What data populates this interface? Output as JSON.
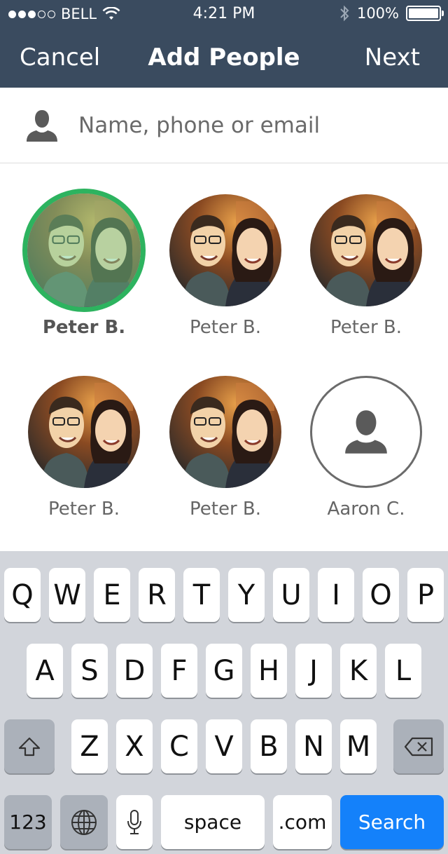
{
  "status_bar": {
    "carrier": "BELL",
    "time": "4:21 PM",
    "battery": "100%",
    "signal_bars_filled": 3,
    "signal_bars_total": 5
  },
  "nav": {
    "cancel_label": "Cancel",
    "title": "Add People",
    "next_label": "Next"
  },
  "search": {
    "placeholder": "Name, phone or email",
    "value": ""
  },
  "people": [
    {
      "name": "Peter B.",
      "selected": true,
      "has_photo": true
    },
    {
      "name": "Peter B.",
      "selected": false,
      "has_photo": true
    },
    {
      "name": "Peter B.",
      "selected": false,
      "has_photo": true
    },
    {
      "name": "Peter B.",
      "selected": false,
      "has_photo": true
    },
    {
      "name": "Peter B.",
      "selected": false,
      "has_photo": true
    },
    {
      "name": "Aaron C.",
      "selected": false,
      "has_photo": false
    }
  ],
  "keyboard": {
    "row1": [
      "Q",
      "W",
      "E",
      "R",
      "T",
      "Y",
      "U",
      "I",
      "O",
      "P"
    ],
    "row2": [
      "A",
      "S",
      "D",
      "F",
      "G",
      "H",
      "J",
      "K",
      "L"
    ],
    "row3": [
      "Z",
      "X",
      "C",
      "V",
      "B",
      "N",
      "M"
    ],
    "numbers_label": "123",
    "space_label": "space",
    "dotcom_label": ".com",
    "search_label": "Search"
  },
  "colors": {
    "nav_background": "#3a4b5f",
    "selected_ring": "#2db35f",
    "search_key": "#1481fa"
  }
}
